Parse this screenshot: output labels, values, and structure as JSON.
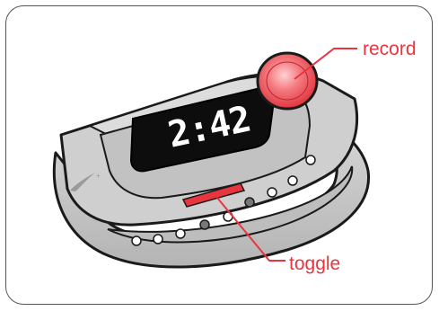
{
  "device": {
    "display_time": "2:42"
  },
  "callouts": {
    "record": "record",
    "toggle": "toggle"
  },
  "colors": {
    "accent_red": "#e8353f",
    "band_gray": "#c8c8c8",
    "display_black": "#0d0d0d",
    "outline": "#1a1a1a"
  },
  "icons": {
    "logo": "swoosh-plus-logo-icon"
  }
}
